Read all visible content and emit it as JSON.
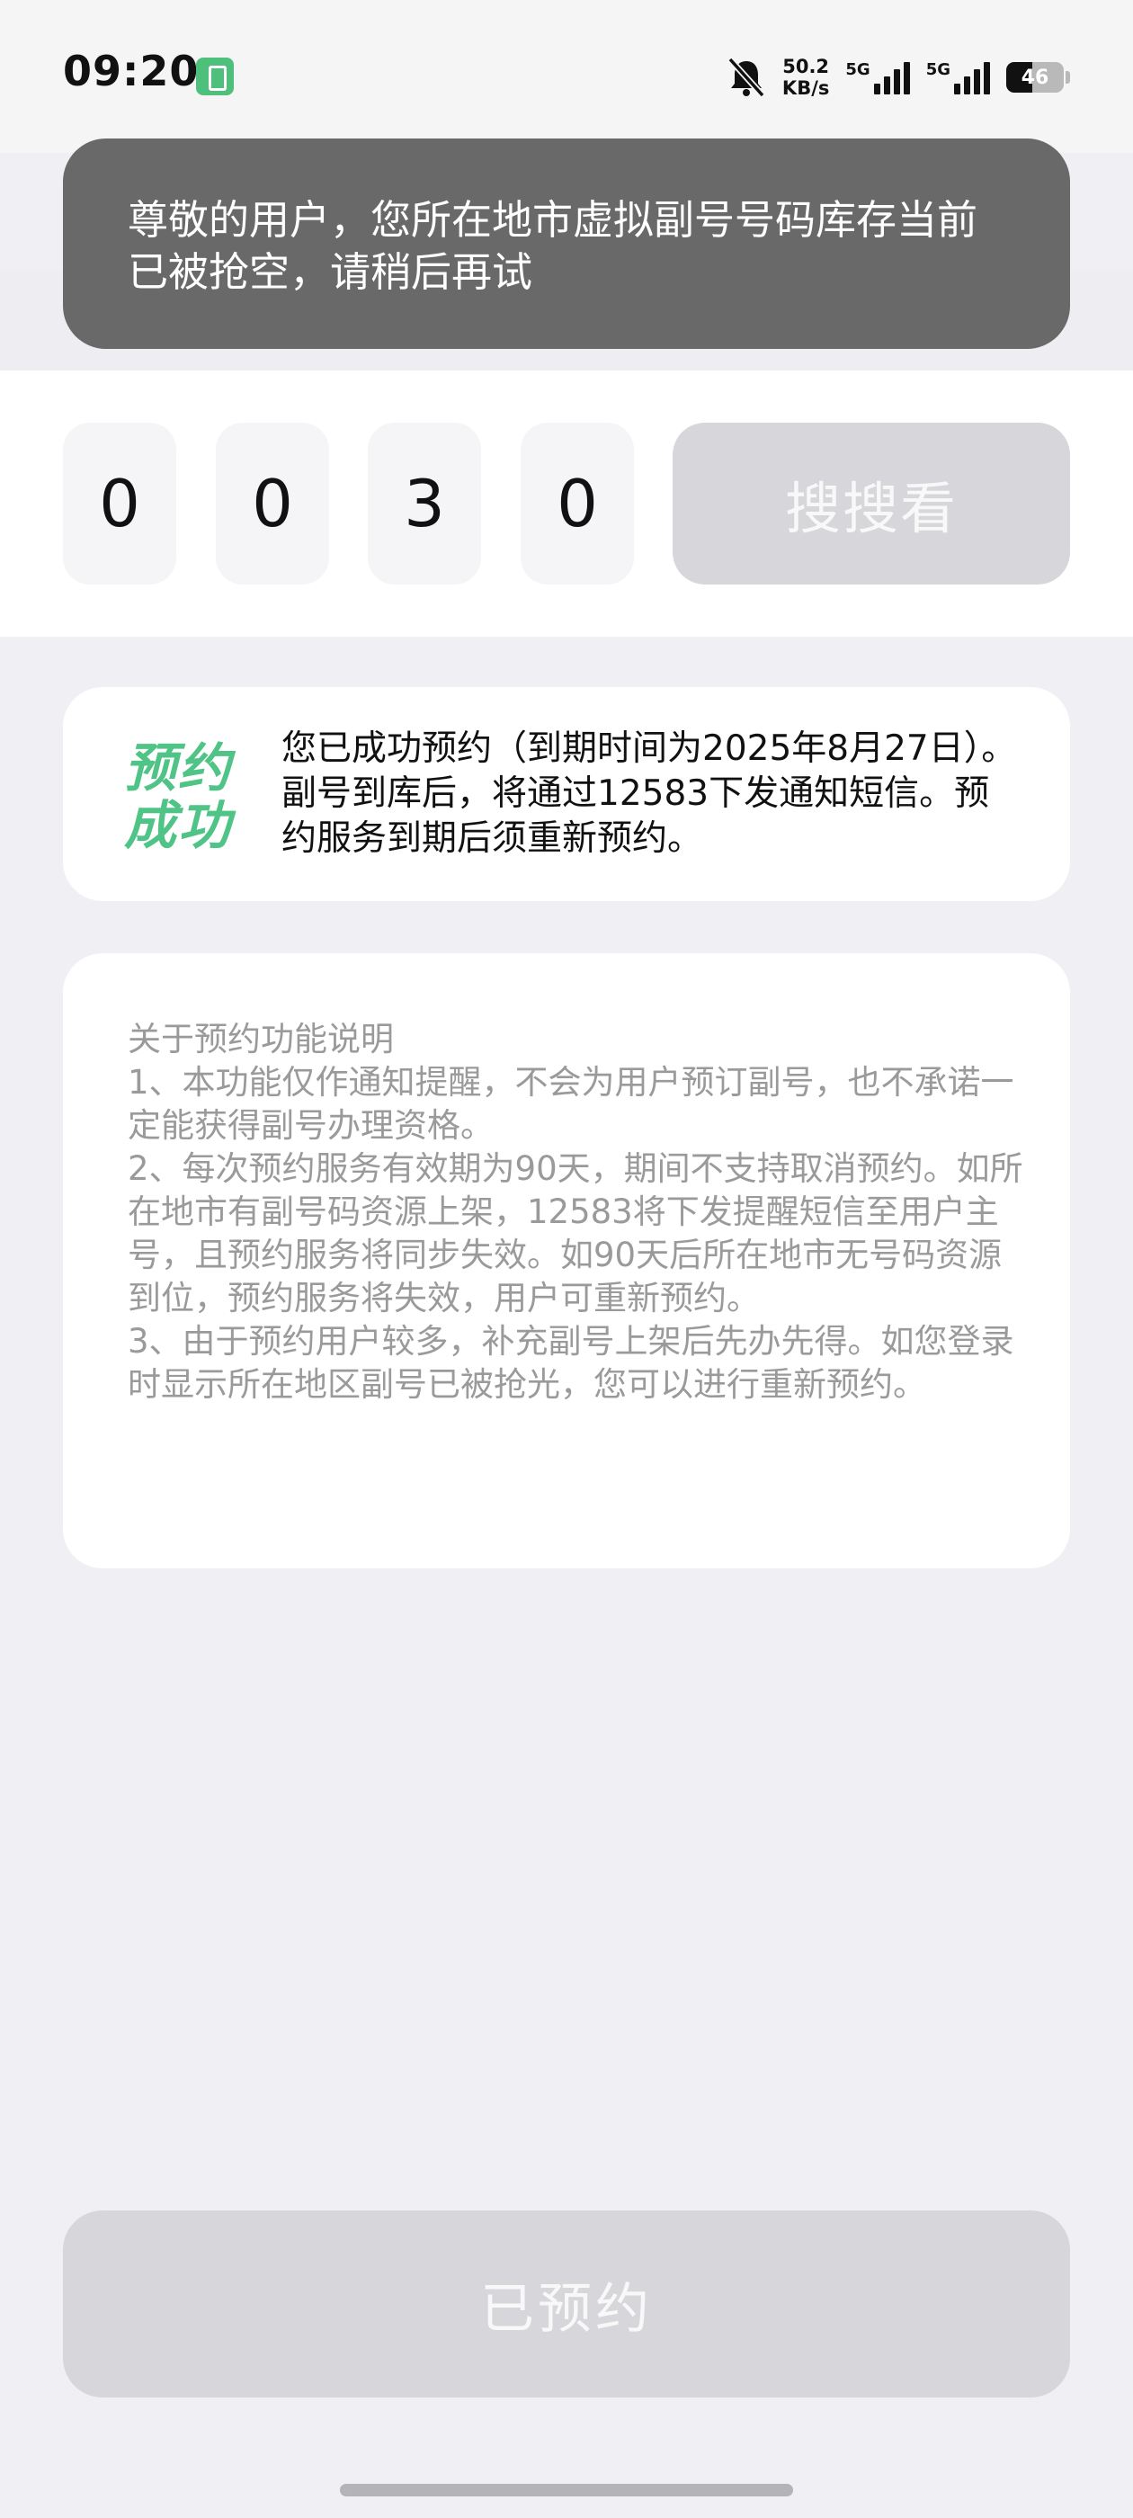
{
  "status_bar": {
    "time": "09:20",
    "net_speed_value": "50.2",
    "net_speed_unit": "KB/s",
    "signal1_label": "5G",
    "signal2_label": "5G",
    "battery_level": "46"
  },
  "toast": {
    "message": "尊敬的用户，您所在地市虚拟副号号码库存当前已被抢空，请稍后再试"
  },
  "search": {
    "digits": [
      "0",
      "0",
      "3",
      "0"
    ],
    "button_label": "搜搜看"
  },
  "reservation": {
    "stamp_line1": "预约",
    "stamp_line2": "成功",
    "message": "您已成功预约（到期时间为2025年8月27日）。副号到库后，将通过12583下发通知短信。预约服务到期后须重新预约。"
  },
  "info": {
    "title": "关于预约功能说明",
    "items": [
      " 1、本功能仅作通知提醒，不会为用户预订副号，也不承诺一定能获得副号办理资格。",
      " 2、每次预约服务有效期为90天，期间不支持取消预约。如所在地市有副号码资源上架，12583将下发提醒短信至用户主号，且预约服务将同步失效。如90天后所在地市无号码资源到位，预约服务将失效，用户可重新预约。",
      " 3、由于预约用户较多，补充副号上架后先办先得。如您登录时显示所在地区副号已被抢光，您可以进行重新预约。"
    ]
  },
  "footer": {
    "button_label": "已预约"
  }
}
